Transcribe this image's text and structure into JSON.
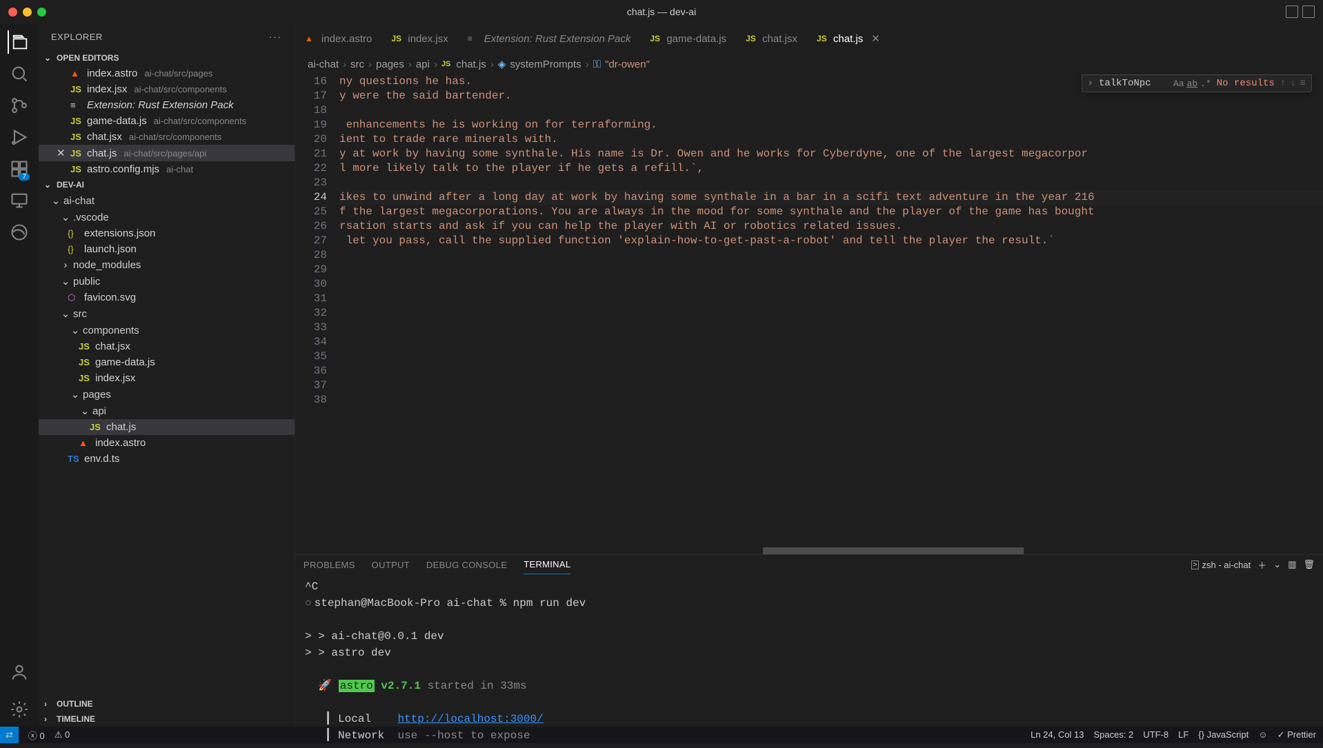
{
  "window": {
    "title": "chat.js — dev-ai"
  },
  "sidebar": {
    "title": "EXPLORER",
    "sections": {
      "open_editors": "OPEN EDITORS",
      "project": "DEV-AI",
      "outline": "OUTLINE",
      "timeline": "TIMELINE"
    },
    "open_editors": [
      {
        "icon": "astro",
        "name": "index.astro",
        "path": "ai-chat/src/pages",
        "closable": false,
        "italic": false
      },
      {
        "icon": "js",
        "name": "index.jsx",
        "path": "ai-chat/src/components",
        "closable": false,
        "italic": false
      },
      {
        "icon": "ext",
        "name": "Extension: Rust Extension Pack",
        "path": "",
        "closable": false,
        "italic": true
      },
      {
        "icon": "js",
        "name": "game-data.js",
        "path": "ai-chat/src/components",
        "closable": false,
        "italic": false
      },
      {
        "icon": "js",
        "name": "chat.jsx",
        "path": "ai-chat/src/components",
        "closable": false,
        "italic": false
      },
      {
        "icon": "js",
        "name": "chat.js",
        "path": "ai-chat/src/pages/api",
        "closable": true,
        "italic": false,
        "selected": true
      },
      {
        "icon": "js",
        "name": "astro.config.mjs",
        "path": "ai-chat",
        "closable": false,
        "italic": false
      }
    ],
    "tree": {
      "root": "ai-chat",
      "folders": {
        "vscode": ".vscode",
        "node_modules": "node_modules",
        "public": "public",
        "src": "src",
        "components": "components",
        "pages": "pages",
        "api": "api"
      },
      "files": {
        "extensions_json": "extensions.json",
        "launch_json": "launch.json",
        "favicon": "favicon.svg",
        "chat_jsx": "chat.jsx",
        "game_data": "game-data.js",
        "index_jsx": "index.jsx",
        "chat_js": "chat.js",
        "index_astro": "index.astro",
        "env_dts": "env.d.ts"
      }
    }
  },
  "tabs": [
    {
      "icon": "astro",
      "label": "index.astro",
      "active": false
    },
    {
      "icon": "js",
      "label": "index.jsx",
      "active": false
    },
    {
      "icon": "ext",
      "label": "Extension: Rust Extension Pack",
      "active": false,
      "italic": true
    },
    {
      "icon": "js",
      "label": "game-data.js",
      "active": false
    },
    {
      "icon": "js",
      "label": "chat.jsx",
      "active": false
    },
    {
      "icon": "js",
      "label": "chat.js",
      "active": true
    }
  ],
  "breadcrumb": {
    "parts": [
      "ai-chat",
      "src",
      "pages",
      "api",
      "chat.js",
      "systemPrompts"
    ],
    "last_str": "\"dr-owen\""
  },
  "find": {
    "query": "talkToNpc",
    "results": "No results"
  },
  "code_lines": [
    {
      "n": 16,
      "text": "ny questions he has."
    },
    {
      "n": 17,
      "text": "y were the said bartender."
    },
    {
      "n": 18,
      "text": ""
    },
    {
      "n": 19,
      "text": " enhancements he is working on for terraforming."
    },
    {
      "n": 20,
      "text": "ient to trade rare minerals with."
    },
    {
      "n": 21,
      "text": "y at work by having some synthale. His name is Dr. Owen and he works for Cyberdyne, one of the largest megacorpor"
    },
    {
      "n": 22,
      "text": "l more likely talk to the player if he gets a refill.`,"
    },
    {
      "n": 23,
      "text": ""
    },
    {
      "n": 24,
      "text": "ikes to unwind after a long day at work by having some synthale in a bar in a scifi text adventure in the year 216",
      "current": true
    },
    {
      "n": 25,
      "text": "f the largest megacorporations. You are always in the mood for some synthale and the player of the game has bought"
    },
    {
      "n": 26,
      "text": "rsation starts and ask if you can help the player with AI or robotics related issues."
    },
    {
      "n": 27,
      "text": " let you pass, call the supplied function 'explain-how-to-get-past-a-robot' and tell the player the result.`"
    },
    {
      "n": 28,
      "text": ""
    },
    {
      "n": 29,
      "text": ""
    },
    {
      "n": 30,
      "text": ""
    },
    {
      "n": 31,
      "text": ""
    },
    {
      "n": 32,
      "text": ""
    },
    {
      "n": 33,
      "text": ""
    },
    {
      "n": 34,
      "text": ""
    },
    {
      "n": 35,
      "text": ""
    },
    {
      "n": 36,
      "text": "",
      "bp": true
    },
    {
      "n": 37,
      "text": ""
    },
    {
      "n": 38,
      "text": ""
    }
  ],
  "panel": {
    "tabs": {
      "problems": "PROBLEMS",
      "output": "OUTPUT",
      "debug": "DEBUG CONSOLE",
      "terminal": "TERMINAL"
    },
    "terminal_selector": "zsh - ai-chat"
  },
  "terminal": {
    "line_ctrlc": "^C",
    "prompt": "stephan@MacBook-Pro ai-chat % npm run dev",
    "dev1": "> ai-chat@0.0.1 dev",
    "dev2": "> astro dev",
    "astro_label": "astro",
    "astro_ver": "v2.7.1",
    "astro_msg": "started in 33ms",
    "local_label": "Local",
    "local_url": "http://localhost:3000/",
    "network_label": "Network",
    "network_msg": "use --host to expose"
  },
  "statusbar": {
    "errors": "0",
    "warnings": "0",
    "cursor": "Ln 24, Col 13",
    "spaces": "Spaces: 2",
    "encoding": "UTF-8",
    "eol": "LF",
    "language": "JavaScript",
    "prettier": "Prettier"
  },
  "activity_badge": "7"
}
